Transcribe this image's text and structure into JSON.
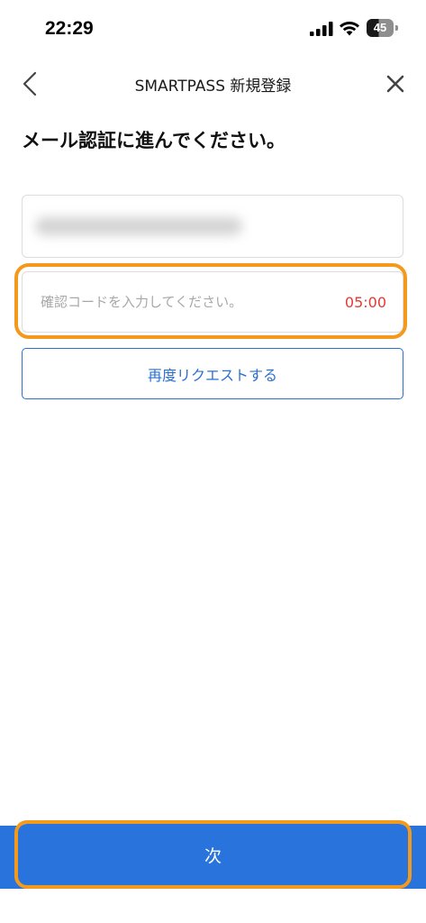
{
  "status_bar": {
    "time": "22:29",
    "battery_level": "45"
  },
  "nav": {
    "title": "SMARTPASS 新規登録"
  },
  "page": {
    "heading": "メール認証に進んでください。"
  },
  "email_field": {
    "value": ""
  },
  "code_field": {
    "placeholder": "確認コードを入力してください。",
    "value": "",
    "timer": "05:00"
  },
  "resend_button": {
    "label": "再度リクエストする"
  },
  "next_button": {
    "label": "次"
  },
  "colors": {
    "primary": "#2873dc",
    "highlight": "#f39a1d",
    "timer": "#e53935"
  }
}
